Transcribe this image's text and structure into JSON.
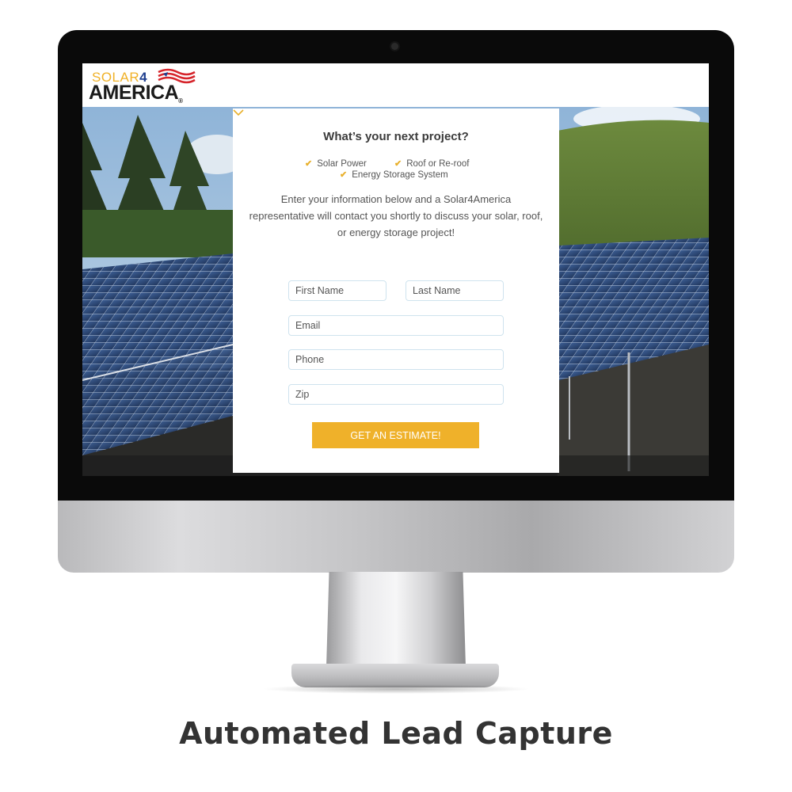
{
  "brand": {
    "logo_top": "SOLAR",
    "logo_num": "4",
    "logo_bottom": "AMERICA",
    "logo_reg": "®",
    "colors": {
      "gold": "#efb12a",
      "flag_red": "#d6242b",
      "flag_blue": "#1f3f8f"
    }
  },
  "form": {
    "title": "What’s your next project?",
    "options": [
      {
        "label": "Solar Power",
        "icon": "check-icon"
      },
      {
        "label": "Roof or Re-roof",
        "icon": "check-icon"
      },
      {
        "label": "Energy Storage System",
        "icon": "check-icon"
      }
    ],
    "description": "Enter your information below and a Solar4America representative will contact you shortly to discuss your solar, roof, or energy storage project!",
    "fields": {
      "first_name": "First Name",
      "last_name": "Last Name",
      "email": "Email",
      "phone": "Phone",
      "zip": "Zip"
    },
    "submit_label": "GET AN ESTIMATE!"
  },
  "caption": "Automated Lead Capture"
}
